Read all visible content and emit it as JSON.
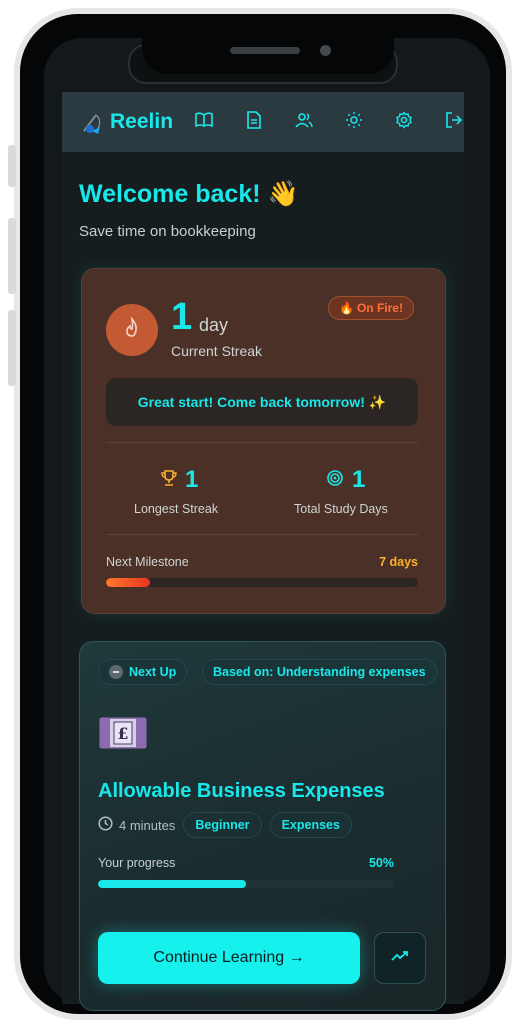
{
  "app": {
    "brand_name": "Reelin",
    "accent_color": "#19e8ea",
    "nav_icons": [
      "book-icon",
      "document-icon",
      "users-icon",
      "sun-icon",
      "settings-icon",
      "logout-icon"
    ]
  },
  "header": {
    "title": "Welcome back!",
    "title_emoji": "👋",
    "subtitle": "Save time on bookkeeping"
  },
  "streak": {
    "count": "1",
    "unit": "day",
    "label": "Current Streak",
    "badge": "On Fire!",
    "message": "Great start! Come back tomorrow! ✨",
    "longest_value": "1",
    "longest_label": "Longest Streak",
    "total_value": "1",
    "total_label": "Total Study Days",
    "milestone_label": "Next Milestone",
    "milestone_value": "7 days",
    "milestone_progress": 0.14
  },
  "next_up": {
    "label": "Next Up",
    "based_on": "Based on: Understanding expenses",
    "lesson_icon": "pound-banknote",
    "title": "Allowable Business Expenses",
    "duration": "4 minutes",
    "tags": [
      "Beginner",
      "Expenses"
    ],
    "progress_label": "Your progress",
    "progress_value": "50%",
    "progress": 0.5,
    "cta_label": "Continue Learning →",
    "secondary_icon": "trending-up-icon"
  }
}
